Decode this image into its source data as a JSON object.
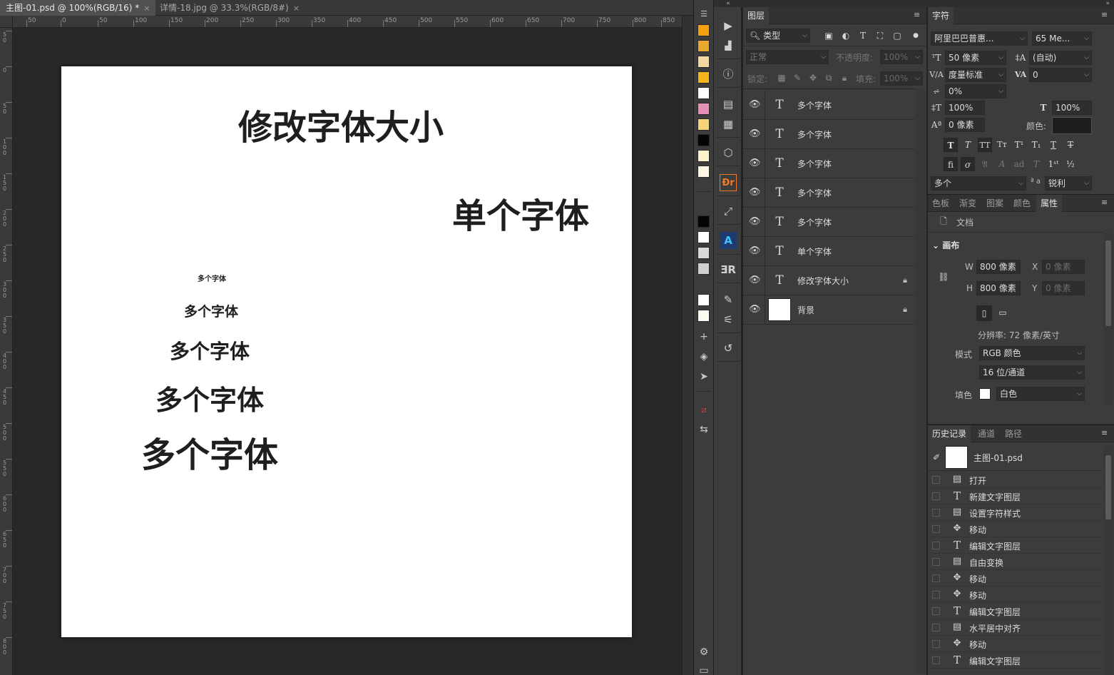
{
  "tabs": [
    {
      "label": "主图-01.psd @ 100%(RGB/16) *",
      "close": "×"
    },
    {
      "label": "详情-18.jpg @ 33.3%(RGB/8#)",
      "close": "×"
    }
  ],
  "ruler_top_labels": [
    "50",
    "0",
    "50",
    "100",
    "150",
    "200",
    "250",
    "300",
    "350",
    "400",
    "450",
    "500",
    "550",
    "600",
    "650",
    "700",
    "750",
    "800",
    "850"
  ],
  "ruler_left_labels": [
    "50",
    "0",
    "50",
    "100",
    "150",
    "200",
    "250",
    "300",
    "350",
    "400",
    "450",
    "500",
    "550",
    "600",
    "650",
    "700",
    "750",
    "800"
  ],
  "canvas": {
    "title": "修改字体大小",
    "single": "单个字体",
    "multi": [
      "多个字体",
      "多个字体",
      "多个字体",
      "多个字体",
      "多个字体"
    ]
  },
  "swatches": {
    "colors": [
      "#f5a00f",
      "#e8a82a",
      "#f3d9a0",
      "#f6b51b",
      "#ffffff",
      "#e690b8",
      "#f8d478",
      "#050505",
      "#fdf2cc",
      "#fdf6e2",
      "#3c3c3c",
      "#050505",
      "#ffffff",
      "#d9d9d9",
      "#d0d0d0",
      "#3c3c3c",
      "#ffffff",
      "#fafaf0"
    ]
  },
  "layers": {
    "title": "图层",
    "filter_label": "类型",
    "blend_mode": "正常",
    "opacity_label": "不透明度:",
    "opacity_value": "100%",
    "lock_label": "锁定:",
    "fill_label": "填充:",
    "fill_value": "100%",
    "items": [
      {
        "name": "多个字体",
        "kind": "text",
        "locked": false
      },
      {
        "name": "多个字体",
        "kind": "text",
        "locked": false
      },
      {
        "name": "多个字体",
        "kind": "text",
        "locked": false
      },
      {
        "name": "多个字体",
        "kind": "text",
        "locked": false
      },
      {
        "name": "多个字体",
        "kind": "text",
        "locked": false
      },
      {
        "name": "单个字体",
        "kind": "text",
        "locked": false
      },
      {
        "name": "修改字体大小",
        "kind": "text",
        "locked": true
      },
      {
        "name": "背景",
        "kind": "image",
        "locked": true
      }
    ]
  },
  "character": {
    "title": "字符",
    "font_family": "阿里巴巴普惠...",
    "font_style": "65 Me...",
    "font_size": "50 像素",
    "leading": "(自动)",
    "kerning": "度量标准",
    "tracking": "0",
    "scale_pct": "0%",
    "vscale": "100%",
    "hscale": "100%",
    "baseline": "0 像素",
    "color_label": "颜色:",
    "language": "多个",
    "aa_prefix": "ª a",
    "antialias": "锐利"
  },
  "props": {
    "tabs": [
      "色板",
      "渐变",
      "图案",
      "颜色",
      "属性"
    ],
    "doc_label": "文档",
    "canvas_section": "画布",
    "w_label": "W",
    "w_value": "800 像素",
    "x_label": "X",
    "x_placeholder": "0 像素",
    "h_label": "H",
    "h_value": "800 像素",
    "y_label": "Y",
    "y_placeholder": "0 像素",
    "resolution": "分辨率: 72 像素/英寸",
    "mode_label": "模式",
    "mode_value": "RGB 颜色",
    "depth_value": "16 位/通道",
    "fill_label": "填色",
    "fill_value": "白色"
  },
  "history": {
    "tabs": [
      "历史记录",
      "通道",
      "路径"
    ],
    "snapshot": "主图-01.psd",
    "items": [
      {
        "icon": "doc",
        "text": "打开"
      },
      {
        "icon": "T",
        "text": "新建文字图层"
      },
      {
        "icon": "doc",
        "text": "设置字符样式"
      },
      {
        "icon": "move",
        "text": "移动"
      },
      {
        "icon": "T",
        "text": "编辑文字图层"
      },
      {
        "icon": "doc",
        "text": "自由变换"
      },
      {
        "icon": "move",
        "text": "移动"
      },
      {
        "icon": "move",
        "text": "移动"
      },
      {
        "icon": "T",
        "text": "编辑文字图层"
      },
      {
        "icon": "doc",
        "text": "水平居中对齐"
      },
      {
        "icon": "move",
        "text": "移动"
      },
      {
        "icon": "T",
        "text": "编辑文字图层"
      }
    ]
  }
}
